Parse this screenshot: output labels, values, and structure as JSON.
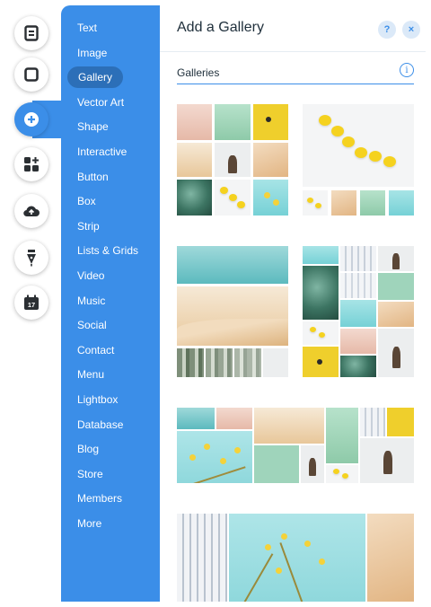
{
  "rail": {
    "buttons": [
      {
        "icon": "pages-icon"
      },
      {
        "icon": "background-icon"
      },
      {
        "icon": "add-icon",
        "active": true
      },
      {
        "icon": "add-apps-icon"
      },
      {
        "icon": "upload-icon"
      },
      {
        "icon": "pen-icon"
      },
      {
        "icon": "calendar-icon",
        "text": "17"
      }
    ]
  },
  "categories": [
    "Text",
    "Image",
    "Gallery",
    "Vector Art",
    "Shape",
    "Interactive",
    "Button",
    "Box",
    "Strip",
    "Lists & Grids",
    "Video",
    "Music",
    "Social",
    "Contact",
    "Menu",
    "Lightbox",
    "Database",
    "Blog",
    "Store",
    "Members",
    "More"
  ],
  "selected_category": "Gallery",
  "panel": {
    "title": "Add a Gallery",
    "help_label": "?",
    "close_label": "×",
    "section_title": "Galleries",
    "info_label": "i"
  },
  "colors": {
    "accent": "#3b8ee8",
    "selected_pill": "#2c6fb8",
    "title_text": "#20303c"
  }
}
